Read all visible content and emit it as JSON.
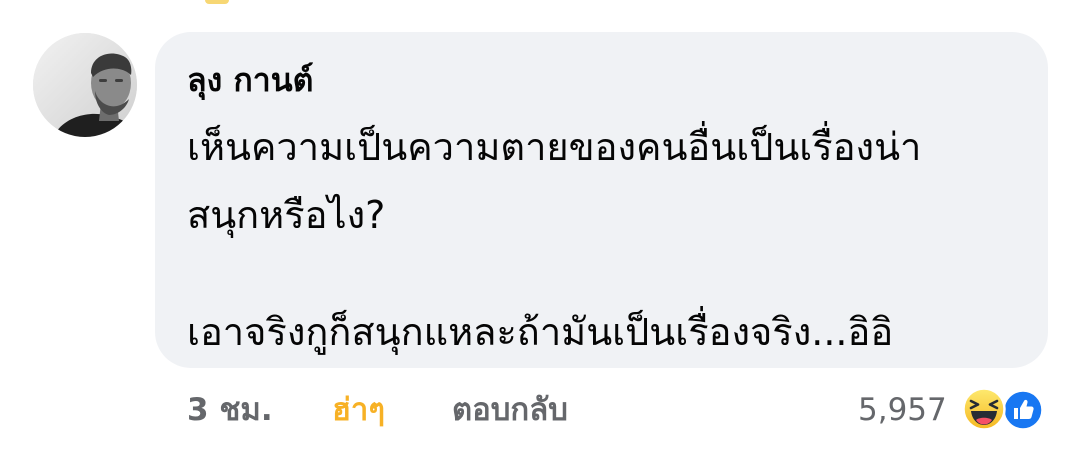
{
  "comment": {
    "author": "ลุง กานต์",
    "lines": [
      "เห็นความเป็นความตายของคนอื่นเป็นเรื่องน่า",
      "สนุกหรือไง?",
      "เอาจริงกูก็สนุกแหละถ้ามันเป็นเรื่องจริง...อิอิ"
    ],
    "avatar_icon": "profile-photo"
  },
  "actions": {
    "time": "3 ชม.",
    "reaction_label": "ฮ่าๆ",
    "reply_label": "ตอบกลับ"
  },
  "reactions": {
    "count": "5,957",
    "icons": [
      "haha-icon",
      "like-icon"
    ]
  },
  "colors": {
    "bubble_bg": "#f0f2f5",
    "text": "#050505",
    "muted": "#65676b",
    "haha_accent": "#f7b125",
    "like_blue": "#1877f2"
  }
}
